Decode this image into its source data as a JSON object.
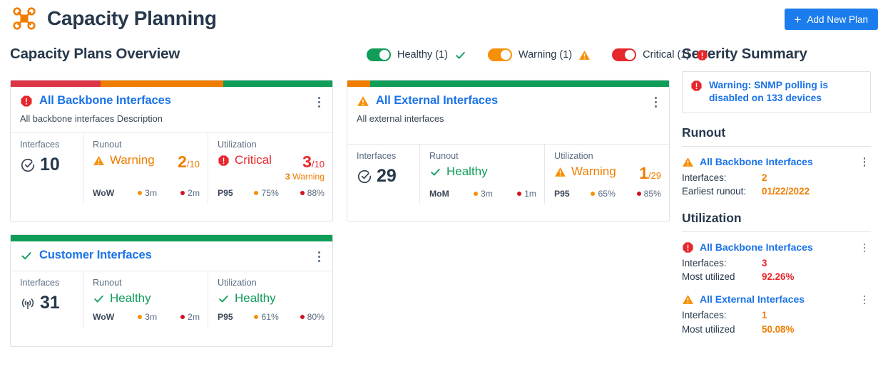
{
  "header": {
    "logo_icon": "hub-node-icon",
    "title": "Capacity Planning",
    "add_button": {
      "label": "Add New Plan",
      "plus": "+",
      "color": "#1b7ced"
    }
  },
  "overview": {
    "title": "Capacity Plans Overview"
  },
  "filters": [
    {
      "label": "Healthy (1)",
      "on": true,
      "color": "#0f9d58",
      "icon": "check-icon",
      "severity": "healthy"
    },
    {
      "label": "Warning (1)",
      "on": true,
      "color": "#f79009",
      "icon": "warning-triangle-icon",
      "severity": "warning"
    },
    {
      "label": "Critical (1)",
      "on": true,
      "color": "#e8272c",
      "icon": "critical-octagon-icon",
      "severity": "critical"
    }
  ],
  "cards": [
    {
      "title": "All Backbone Interfaces",
      "description": "All backbone interfaces Description",
      "status_icon": "critical-octagon-icon",
      "status": "critical",
      "bar": [
        {
          "color": "#dc3545",
          "pct": 28
        },
        {
          "color": "#ef7d00",
          "pct": 38
        },
        {
          "color": "#0f9d58",
          "pct": 34
        }
      ],
      "interfaces": {
        "label": "Interfaces",
        "icon": "clock-check-icon",
        "value": "10"
      },
      "runout": {
        "label": "Runout",
        "status": "Warning",
        "status_kind": "warning",
        "status_icon": "warning-triangle-icon",
        "count": "2",
        "denominator": "/10",
        "sub": null,
        "algo": "WoW",
        "thresholds": [
          {
            "value": "3m",
            "color": "#f79009"
          },
          {
            "value": "2m",
            "color": "#cf1322"
          }
        ]
      },
      "utilization": {
        "label": "Utilization",
        "status": "Critical",
        "status_kind": "critical",
        "status_icon": "critical-octagon-icon",
        "count": "3",
        "denominator": "/10",
        "sub_count": "3",
        "sub_label": "Warning",
        "algo": "P95",
        "thresholds": [
          {
            "value": "75%",
            "color": "#f79009"
          },
          {
            "value": "88%",
            "color": "#cf1322"
          }
        ]
      }
    },
    {
      "title": "All External Interfaces",
      "description": "All external interfaces",
      "status_icon": "warning-triangle-icon",
      "status": "warning",
      "bar": [
        {
          "color": "#ef7d00",
          "pct": 7
        },
        {
          "color": "#0f9d58",
          "pct": 93
        }
      ],
      "interfaces": {
        "label": "Interfaces",
        "icon": "clock-check-icon",
        "value": "29"
      },
      "runout": {
        "label": "Runout",
        "status": "Healthy",
        "status_kind": "healthy",
        "status_icon": "check-icon",
        "count": null,
        "denominator": null,
        "algo": "MoM",
        "thresholds": [
          {
            "value": "3m",
            "color": "#f79009"
          },
          {
            "value": "1m",
            "color": "#cf1322"
          }
        ]
      },
      "utilization": {
        "label": "Utilization",
        "status": "Warning",
        "status_kind": "warning",
        "status_icon": "warning-triangle-icon",
        "count": "1",
        "denominator": "/29",
        "sub_count": null,
        "sub_label": null,
        "algo": "P95",
        "thresholds": [
          {
            "value": "65%",
            "color": "#f79009"
          },
          {
            "value": "85%",
            "color": "#cf1322"
          }
        ]
      }
    },
    {
      "title": "Customer Interfaces",
      "description": null,
      "status_icon": "check-icon",
      "status": "healthy",
      "bar": [
        {
          "color": "#0f9d58",
          "pct": 100
        }
      ],
      "interfaces": {
        "label": "Interfaces",
        "icon": "antenna-signal-icon",
        "value": "31"
      },
      "runout": {
        "label": "Runout",
        "status": "Healthy",
        "status_kind": "healthy",
        "status_icon": "check-icon",
        "count": null,
        "denominator": null,
        "algo": "WoW",
        "thresholds": [
          {
            "value": "3m",
            "color": "#f79009"
          },
          {
            "value": "2m",
            "color": "#cf1322"
          }
        ]
      },
      "utilization": {
        "label": "Utilization",
        "status": "Healthy",
        "status_kind": "healthy",
        "status_icon": "check-icon",
        "count": null,
        "denominator": null,
        "sub_count": null,
        "sub_label": null,
        "algo": "P95",
        "thresholds": [
          {
            "value": "61%",
            "color": "#f79009"
          },
          {
            "value": "80%",
            "color": "#cf1322"
          }
        ]
      }
    }
  ],
  "severity_summary": {
    "title": "Severity Summary",
    "banner": {
      "icon": "critical-octagon-icon",
      "text": "Warning: SNMP polling is disabled on 133 devices"
    },
    "groups": [
      {
        "title": "Runout",
        "items": [
          {
            "name": "All Backbone Interfaces",
            "icon": "warning-triangle-icon",
            "severity": "warning",
            "rows": [
              {
                "key": "Interfaces:",
                "value": "2"
              },
              {
                "key": "Earliest runout:",
                "value": "01/22/2022"
              }
            ]
          }
        ]
      },
      {
        "title": "Utilization",
        "items": [
          {
            "name": "All Backbone Interfaces",
            "icon": "critical-octagon-icon",
            "severity": "critical",
            "rows": [
              {
                "key": "Interfaces:",
                "value": "3"
              },
              {
                "key": "Most utilized",
                "value": "92.26%"
              }
            ]
          },
          {
            "name": "All External Interfaces",
            "icon": "warning-triangle-icon",
            "severity": "warning",
            "rows": [
              {
                "key": "Interfaces:",
                "value": "1"
              },
              {
                "key": "Most utilized",
                "value": "50.08%"
              }
            ]
          }
        ]
      }
    ]
  }
}
